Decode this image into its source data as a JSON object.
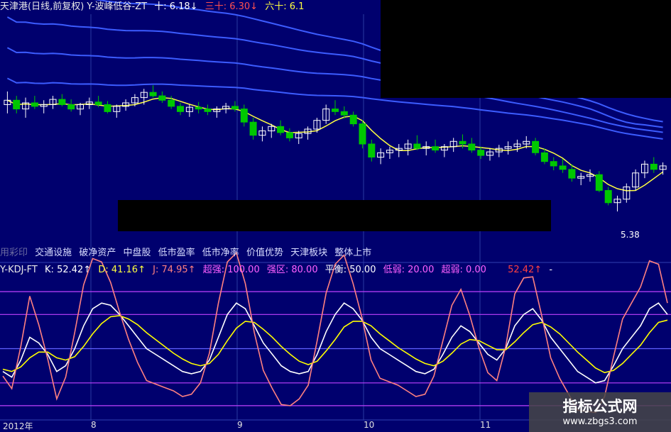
{
  "header": {
    "title": "天津港(日线,前复权) Y-波峰低谷-ZT",
    "ma10_label": "十: 6.18↓",
    "ma30_label": "三十: 6.30↓",
    "ma60_label": "六十: 6.1"
  },
  "tags": [
    "交通设施",
    "破净资产",
    "中盘股",
    "低市盈率",
    "低市净率",
    "价值优势",
    "天津板块",
    "整体上市"
  ],
  "tags_prefix": "用彩印",
  "kdj_bar": {
    "name": "Y-KDJ-FT",
    "k": "K: 52.42↑",
    "d": "D: 41.16↑",
    "j": "J: 74.95↑",
    "super_strong": "超强: 100.00",
    "strong": "强区: 80.00",
    "balance": "平衡: 50.00",
    "weak": "低弱: 20.00",
    "super_weak": "超弱: 0.00",
    "k_right": "52.42↑",
    "tail": "-"
  },
  "price_label": "5.38",
  "dates": [
    "2012年",
    "8",
    "9",
    "10",
    "11"
  ],
  "watermark": {
    "line1": "指标公式网",
    "line2": "www.zbgs3.com"
  },
  "colors": {
    "background": "#00006e",
    "up": "#ff3030",
    "down": "#00c800",
    "ma_blue": "#3c5cff",
    "ma_yellow": "#ffff40",
    "k_line": "#ffffff",
    "d_line": "#ffff00",
    "j_line": "#ff8080",
    "kdj_red": "#ff2020",
    "ref_line": "#c040ff"
  },
  "chart_data": [
    {
      "type": "candlestick",
      "title": "天津港(日线,前复权)",
      "ylim": [
        5.0,
        7.6
      ],
      "candles": [
        [
          6.6,
          6.75,
          6.5,
          6.65
        ],
        [
          6.65,
          6.7,
          6.5,
          6.55
        ],
        [
          6.55,
          6.68,
          6.45,
          6.62
        ],
        [
          6.62,
          6.7,
          6.55,
          6.58
        ],
        [
          6.58,
          6.65,
          6.5,
          6.6
        ],
        [
          6.6,
          6.7,
          6.55,
          6.66
        ],
        [
          6.66,
          6.72,
          6.58,
          6.6
        ],
        [
          6.6,
          6.66,
          6.52,
          6.55
        ],
        [
          6.55,
          6.62,
          6.48,
          6.6
        ],
        [
          6.6,
          6.68,
          6.55,
          6.63
        ],
        [
          6.63,
          6.7,
          6.57,
          6.6
        ],
        [
          6.6,
          6.64,
          6.5,
          6.52
        ],
        [
          6.52,
          6.6,
          6.45,
          6.58
        ],
        [
          6.58,
          6.66,
          6.53,
          6.62
        ],
        [
          6.62,
          6.72,
          6.58,
          6.68
        ],
        [
          6.68,
          6.78,
          6.6,
          6.74
        ],
        [
          6.74,
          6.82,
          6.68,
          6.7
        ],
        [
          6.7,
          6.75,
          6.62,
          6.65
        ],
        [
          6.65,
          6.7,
          6.55,
          6.58
        ],
        [
          6.58,
          6.62,
          6.48,
          6.52
        ],
        [
          6.52,
          6.6,
          6.46,
          6.57
        ],
        [
          6.57,
          6.63,
          6.5,
          6.55
        ],
        [
          6.55,
          6.6,
          6.48,
          6.52
        ],
        [
          6.52,
          6.58,
          6.45,
          6.55
        ],
        [
          6.55,
          6.62,
          6.5,
          6.58
        ],
        [
          6.58,
          6.64,
          6.52,
          6.55
        ],
        [
          6.55,
          6.6,
          6.35,
          6.4
        ],
        [
          6.4,
          6.45,
          6.2,
          6.25
        ],
        [
          6.25,
          6.35,
          6.18,
          6.3
        ],
        [
          6.3,
          6.38,
          6.22,
          6.35
        ],
        [
          6.35,
          6.42,
          6.25,
          6.28
        ],
        [
          6.28,
          6.33,
          6.18,
          6.22
        ],
        [
          6.22,
          6.3,
          6.15,
          6.27
        ],
        [
          6.27,
          6.35,
          6.2,
          6.32
        ],
        [
          6.32,
          6.45,
          6.28,
          6.42
        ],
        [
          6.42,
          6.6,
          6.38,
          6.55
        ],
        [
          6.55,
          6.65,
          6.48,
          6.52
        ],
        [
          6.52,
          6.58,
          6.44,
          6.48
        ],
        [
          6.48,
          6.52,
          6.35,
          6.38
        ],
        [
          6.38,
          6.42,
          6.1,
          6.15
        ],
        [
          6.15,
          6.2,
          5.95,
          6.0
        ],
        [
          6.0,
          6.1,
          5.92,
          6.05
        ],
        [
          6.05,
          6.12,
          5.98,
          6.08
        ],
        [
          6.08,
          6.15,
          6.0,
          6.1
        ],
        [
          6.1,
          6.2,
          6.02,
          6.15
        ],
        [
          6.15,
          6.25,
          6.08,
          6.1
        ],
        [
          6.1,
          6.18,
          6.02,
          6.12
        ],
        [
          6.12,
          6.2,
          6.05,
          6.08
        ],
        [
          6.08,
          6.15,
          6.0,
          6.12
        ],
        [
          6.12,
          6.22,
          6.06,
          6.18
        ],
        [
          6.18,
          6.26,
          6.1,
          6.15
        ],
        [
          6.15,
          6.22,
          6.05,
          6.08
        ],
        [
          6.08,
          6.12,
          5.98,
          6.02
        ],
        [
          6.02,
          6.1,
          5.96,
          6.06
        ],
        [
          6.06,
          6.14,
          6.0,
          6.1
        ],
        [
          6.1,
          6.18,
          6.03,
          6.12
        ],
        [
          6.12,
          6.2,
          6.06,
          6.15
        ],
        [
          6.15,
          6.24,
          6.1,
          6.18
        ],
        [
          6.18,
          6.22,
          6.02,
          6.05
        ],
        [
          6.05,
          6.1,
          5.92,
          5.95
        ],
        [
          5.95,
          6.0,
          5.85,
          5.9
        ],
        [
          5.9,
          5.98,
          5.82,
          5.86
        ],
        [
          5.86,
          5.92,
          5.72,
          5.76
        ],
        [
          5.76,
          5.82,
          5.68,
          5.78
        ],
        [
          5.78,
          5.86,
          5.72,
          5.8
        ],
        [
          5.8,
          5.84,
          5.6,
          5.62
        ],
        [
          5.62,
          5.66,
          5.45,
          5.48
        ],
        [
          5.48,
          5.56,
          5.38,
          5.52
        ],
        [
          5.52,
          5.7,
          5.48,
          5.66
        ],
        [
          5.66,
          5.86,
          5.62,
          5.82
        ],
        [
          5.82,
          5.96,
          5.76,
          5.92
        ],
        [
          5.92,
          6.0,
          5.82,
          5.86
        ],
        [
          5.86,
          5.94,
          5.8,
          5.9
        ]
      ],
      "low_label": 5.38
    },
    {
      "type": "line",
      "title": "Y-KDJ-FT",
      "ylim": [
        -10,
        110
      ],
      "reference_lines": [
        100,
        80,
        50,
        20,
        0
      ],
      "series": [
        {
          "name": "K",
          "values": [
            30,
            25,
            40,
            60,
            55,
            45,
            30,
            35,
            50,
            70,
            85,
            90,
            88,
            80,
            70,
            60,
            50,
            45,
            40,
            35,
            30,
            28,
            30,
            40,
            60,
            80,
            90,
            85,
            70,
            55,
            45,
            35,
            30,
            28,
            30,
            45,
            65,
            80,
            90,
            85,
            75,
            60,
            50,
            45,
            40,
            35,
            30,
            28,
            32,
            45,
            60,
            70,
            65,
            55,
            45,
            40,
            50,
            70,
            80,
            85,
            75,
            60,
            50,
            40,
            30,
            25,
            20,
            22,
            35,
            50,
            60,
            70,
            85,
            90,
            80
          ]
        },
        {
          "name": "D",
          "values": [
            32,
            30,
            34,
            42,
            47,
            47,
            42,
            40,
            43,
            52,
            63,
            72,
            78,
            79,
            76,
            71,
            64,
            58,
            52,
            46,
            41,
            37,
            35,
            37,
            45,
            57,
            68,
            74,
            73,
            67,
            60,
            52,
            45,
            39,
            36,
            39,
            48,
            58,
            69,
            74,
            74,
            70,
            63,
            57,
            51,
            46,
            41,
            37,
            35,
            39,
            46,
            54,
            58,
            57,
            53,
            49,
            49,
            56,
            64,
            71,
            73,
            69,
            63,
            55,
            47,
            40,
            33,
            29,
            31,
            37,
            45,
            53,
            64,
            73,
            75
          ]
        },
        {
          "name": "J",
          "values": [
            26,
            15,
            52,
            96,
            71,
            41,
            6,
            25,
            64,
            106,
            129,
            126,
            108,
            82,
            58,
            38,
            22,
            19,
            16,
            13,
            8,
            10,
            20,
            46,
            90,
            126,
            134,
            107,
            64,
            31,
            15,
            1,
            0,
            6,
            18,
            57,
            99,
            124,
            132,
            107,
            77,
            40,
            24,
            21,
            18,
            13,
            8,
            10,
            26,
            57,
            88,
            102,
            79,
            51,
            29,
            22,
            52,
            98,
            112,
            113,
            79,
            42,
            24,
            10,
            -4,
            -5,
            -6,
            8,
            43,
            76,
            90,
            104,
            127,
            124,
            90
          ]
        }
      ]
    }
  ]
}
